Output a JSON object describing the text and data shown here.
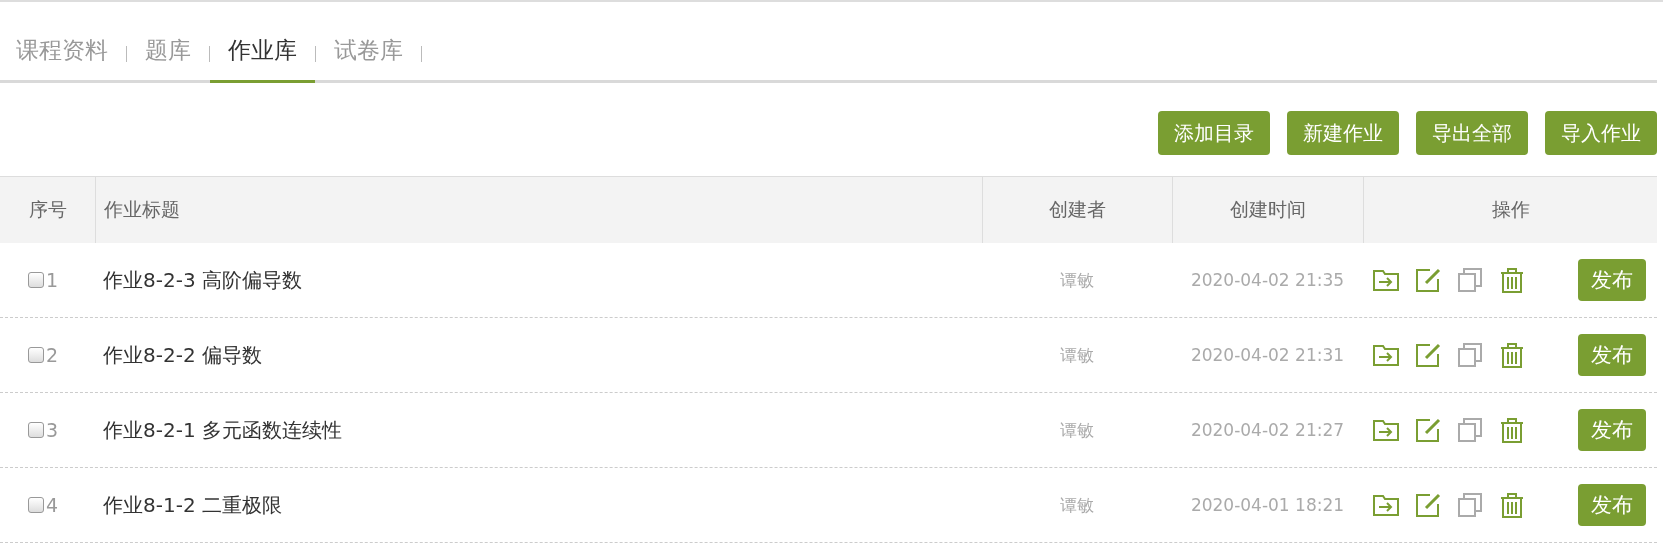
{
  "tabs": [
    {
      "label": "课程资料",
      "selected": false
    },
    {
      "label": "题库",
      "selected": false
    },
    {
      "label": "作业库",
      "selected": true
    },
    {
      "label": "试卷库",
      "selected": false
    }
  ],
  "toolbar_buttons": [
    "添加目录",
    "新建作业",
    "导出全部",
    "导入作业"
  ],
  "table": {
    "columns": [
      "序号",
      "作业标题",
      "创建者",
      "创建时间",
      "操作"
    ],
    "rows": [
      {
        "checked": false,
        "index": "1",
        "title": "作业8-2-3 高阶偏导数",
        "creator": "谭敏",
        "created": "2020-04-02 21:35",
        "action": "发布"
      },
      {
        "checked": false,
        "index": "2",
        "title": "作业8-2-2 偏导数",
        "creator": "谭敏",
        "created": "2020-04-02 21:31",
        "action": "发布"
      },
      {
        "checked": false,
        "index": "3",
        "title": "作业8-2-1 多元函数连续性",
        "creator": "谭敏",
        "created": "2020-04-02 21:27",
        "action": "发布"
      },
      {
        "checked": false,
        "index": "4",
        "title": "作业8-1-2 二重极限",
        "creator": "谭敏",
        "created": "2020-04-01 18:21",
        "action": "发布"
      }
    ]
  }
}
